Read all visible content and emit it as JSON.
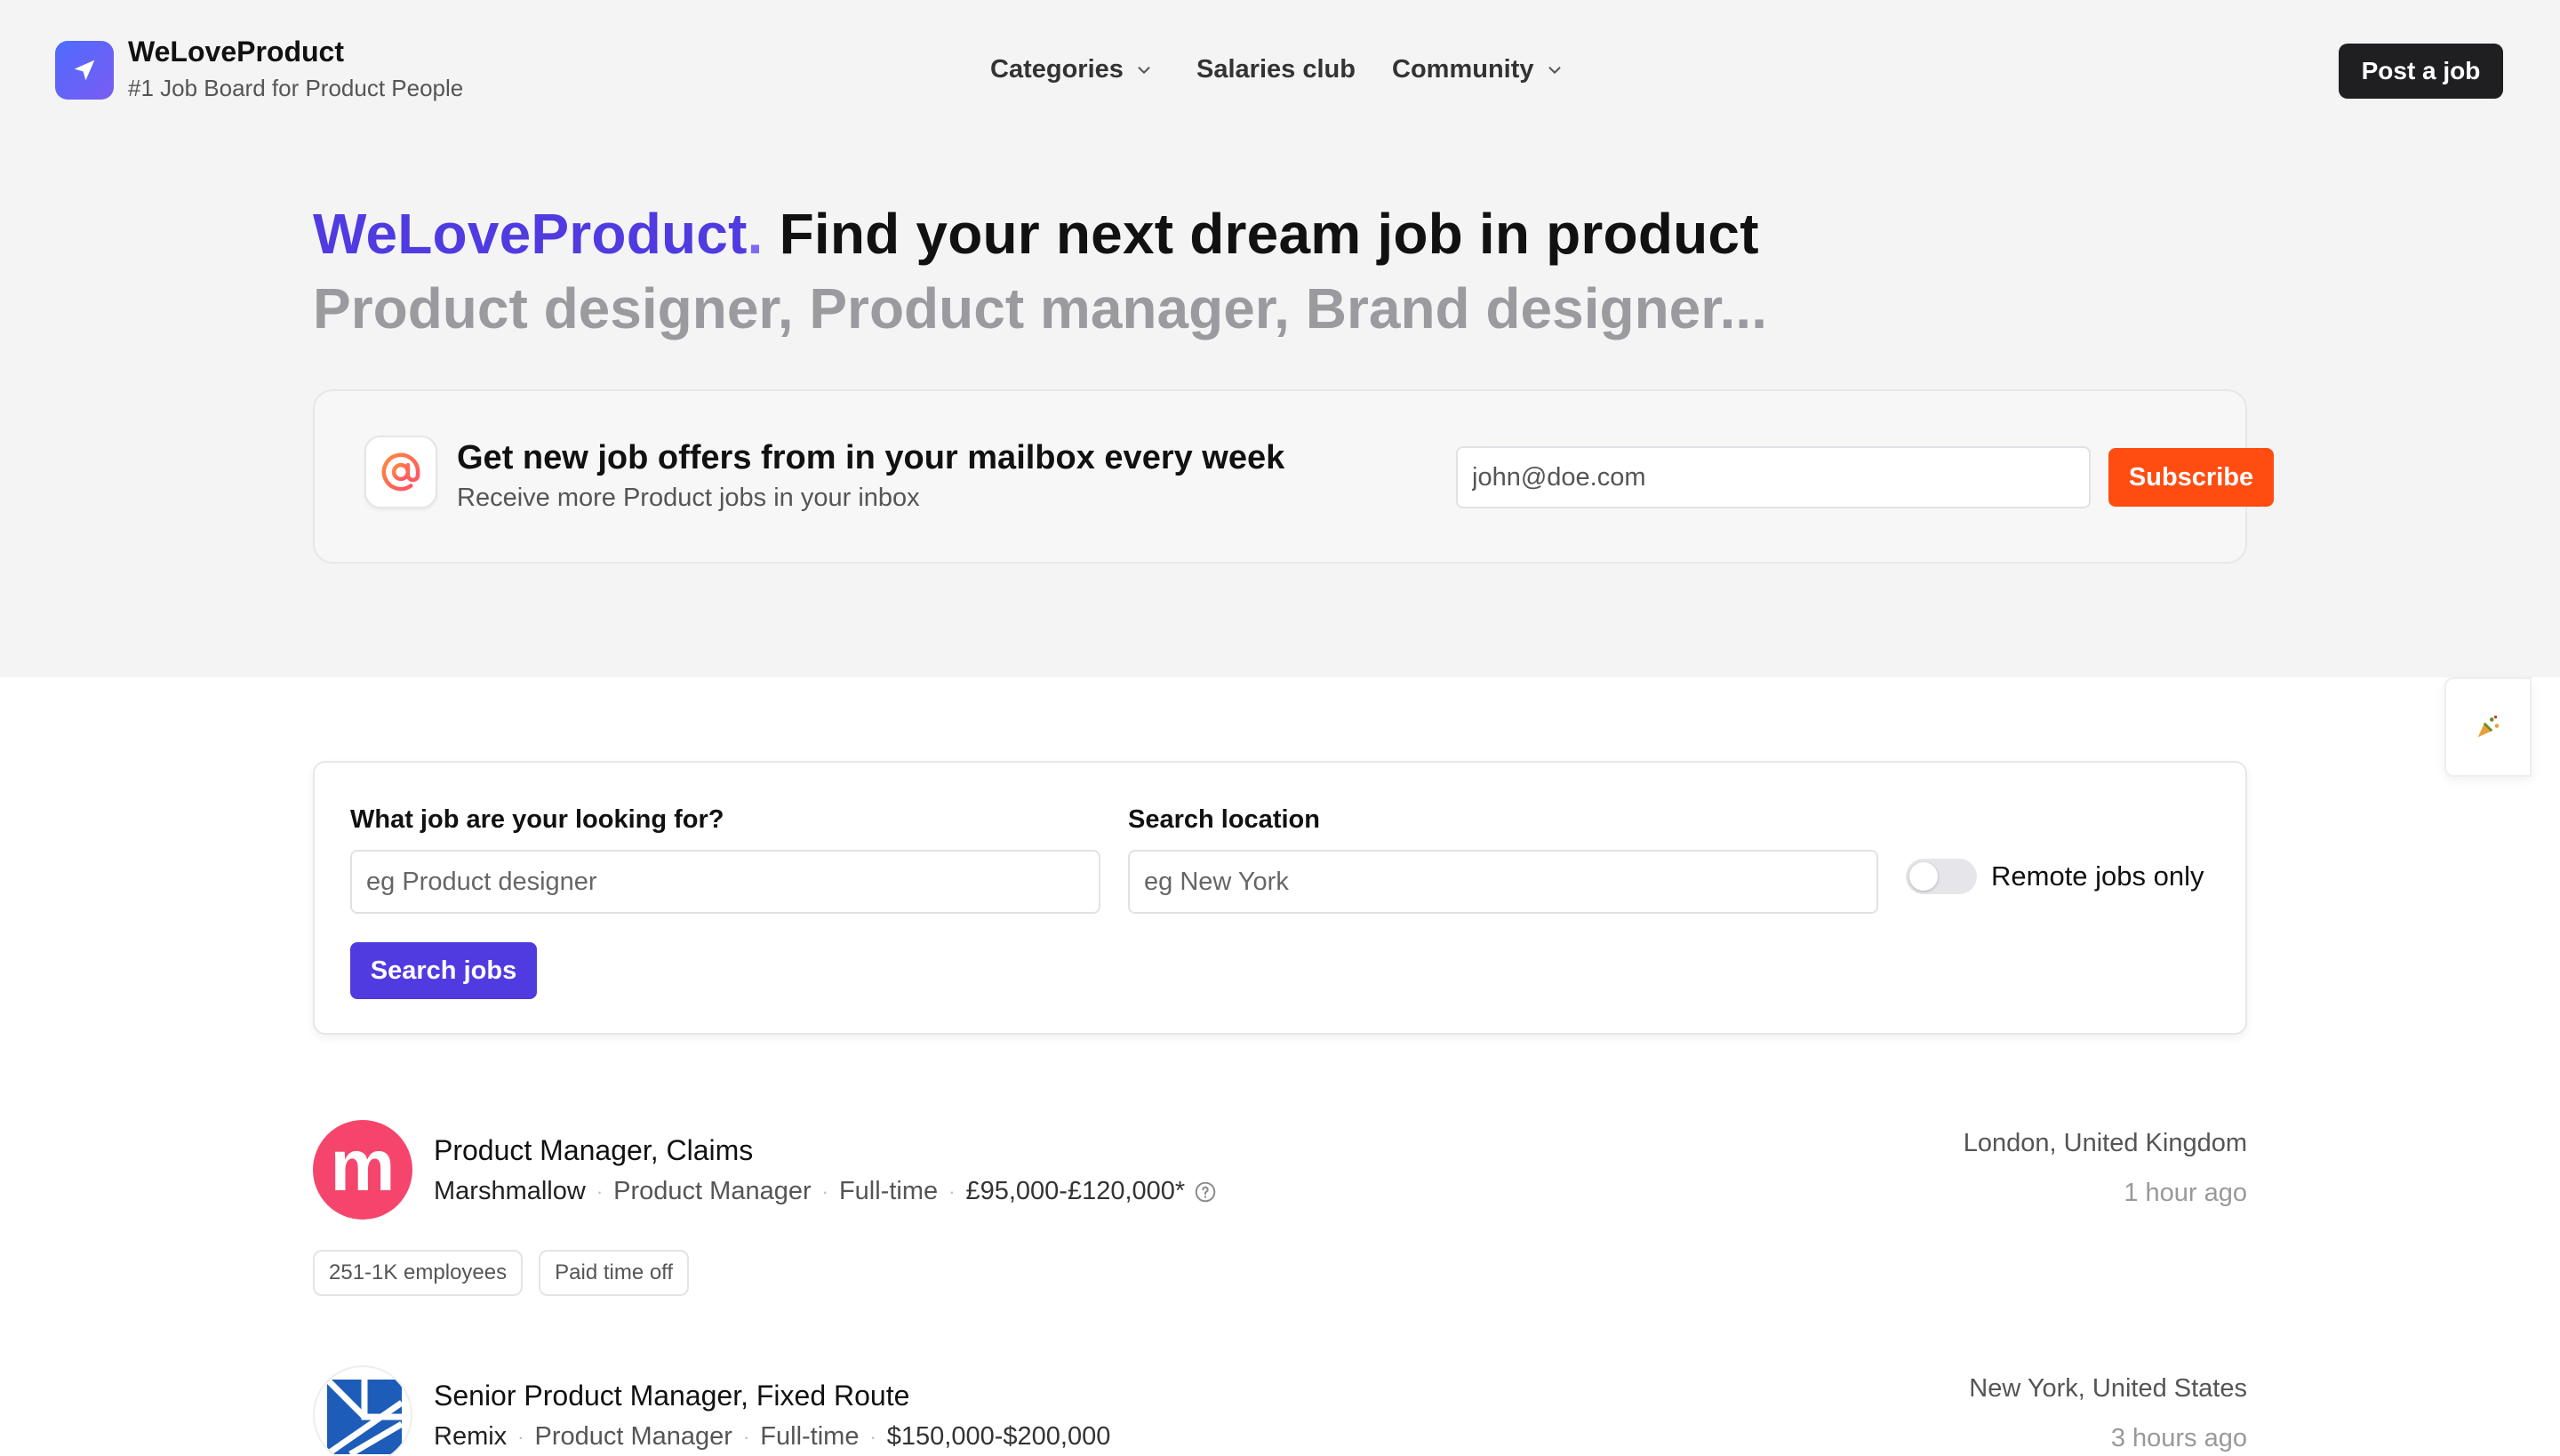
{
  "header": {
    "brand_name": "WeLoveProduct",
    "tagline": "#1 Job Board for Product People",
    "nav": [
      {
        "label": "Categories",
        "has_dropdown": true
      },
      {
        "label": "Salaries club",
        "has_dropdown": false
      },
      {
        "label": "Community",
        "has_dropdown": true
      }
    ],
    "post_job_label": "Post a job",
    "logo_icon": "paper-plane-icon"
  },
  "hero": {
    "brand": "WeLoveProduct",
    "brand_dot": ".",
    "headline": " Find your next dream job in product",
    "subline": "Product designer, Product manager, Brand designer..."
  },
  "newsletter": {
    "icon": "at-sign-icon",
    "title": "Get new job offers from in your mailbox every week",
    "subtitle": "Receive more Product jobs in your inbox",
    "email_placeholder": "john@doe.com",
    "subscribe_label": "Subscribe"
  },
  "search": {
    "job_label": "What job are your looking for?",
    "job_placeholder": "eg Product designer",
    "location_label": "Search location",
    "location_placeholder": "eg New York",
    "remote_label": "Remote jobs only",
    "remote_on": false,
    "search_label": "Search jobs"
  },
  "jobs": [
    {
      "title": "Product Manager, Claims",
      "company": "Marshmallow",
      "category": "Product Manager",
      "type": "Full-time",
      "salary": "£95,000-£120,000*",
      "location": "London, United Kingdom",
      "posted": "1 hour ago",
      "tags": [
        "251-1K employees",
        "Paid time off"
      ],
      "logo_color": "#f6456c",
      "logo_letter": "m"
    },
    {
      "title": "Senior Product Manager, Fixed Route",
      "company": "Remix",
      "category": "Product Manager",
      "type": "Full-time",
      "salary": "$150,000-$200,000",
      "location": "New York, United States",
      "posted": "3 hours ago",
      "tags": [],
      "logo_color": "#1d5cb8"
    }
  ],
  "colors": {
    "accent": "#4f3be0",
    "subscribe": "#ff4d12",
    "hero_bg": "#f4f4f5"
  }
}
